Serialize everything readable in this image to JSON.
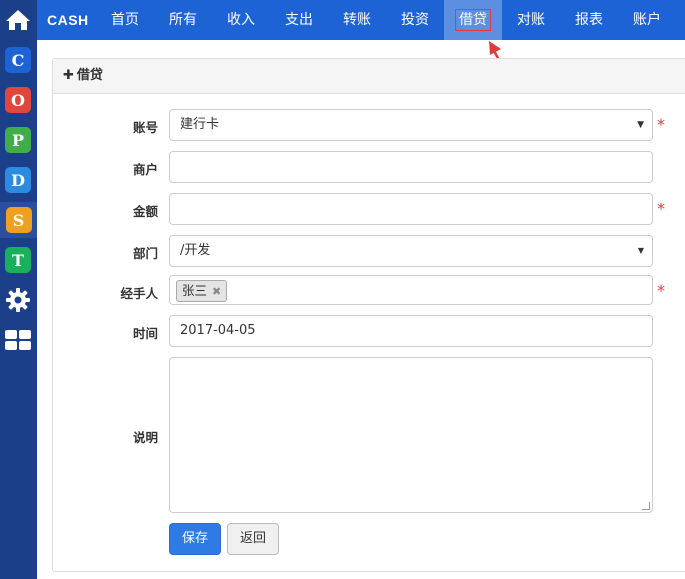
{
  "brand": "CASH",
  "nav": {
    "items": [
      {
        "label": "首页"
      },
      {
        "label": "所有"
      },
      {
        "label": "收入"
      },
      {
        "label": "支出"
      },
      {
        "label": "转账"
      },
      {
        "label": "投资"
      },
      {
        "label": "借贷",
        "active": true
      },
      {
        "label": "对账"
      },
      {
        "label": "报表"
      },
      {
        "label": "账户"
      }
    ]
  },
  "rail": {
    "items": [
      {
        "icon": "home-icon"
      },
      {
        "icon": "app-c-icon",
        "letter": "C",
        "color": "#1e63d6"
      },
      {
        "icon": "app-o-icon",
        "letter": "O",
        "color": "#e0463c"
      },
      {
        "icon": "app-p-icon",
        "letter": "P",
        "color": "#3fae4a"
      },
      {
        "icon": "app-d-icon",
        "letter": "D",
        "color": "#2a8be0"
      },
      {
        "icon": "app-s-icon",
        "letter": "S",
        "color": "#f0a020",
        "active": true
      },
      {
        "icon": "app-t-icon",
        "letter": "T",
        "color": "#18b05a"
      },
      {
        "icon": "gear-icon"
      },
      {
        "icon": "grid-icon"
      }
    ]
  },
  "panel": {
    "title": "借贷"
  },
  "form": {
    "account": {
      "label": "账号",
      "value": "建行卡",
      "required": true
    },
    "merchant": {
      "label": "商户",
      "value": ""
    },
    "amount": {
      "label": "金额",
      "value": "",
      "required": true
    },
    "department": {
      "label": "部门",
      "value": "/开发"
    },
    "handler": {
      "label": "经手人",
      "tag": "张三",
      "required": true
    },
    "time": {
      "label": "时间",
      "value": "2017-04-05"
    },
    "note": {
      "label": "说明",
      "value": ""
    },
    "required_mark": "*"
  },
  "buttons": {
    "save": "保存",
    "back": "返回"
  },
  "colors": {
    "nav_bg": "#1e63d6",
    "rail_bg": "#1c3f8a",
    "primary": "#2e7be6",
    "required": "#e03c3c",
    "annotation": "#e03c3c"
  }
}
